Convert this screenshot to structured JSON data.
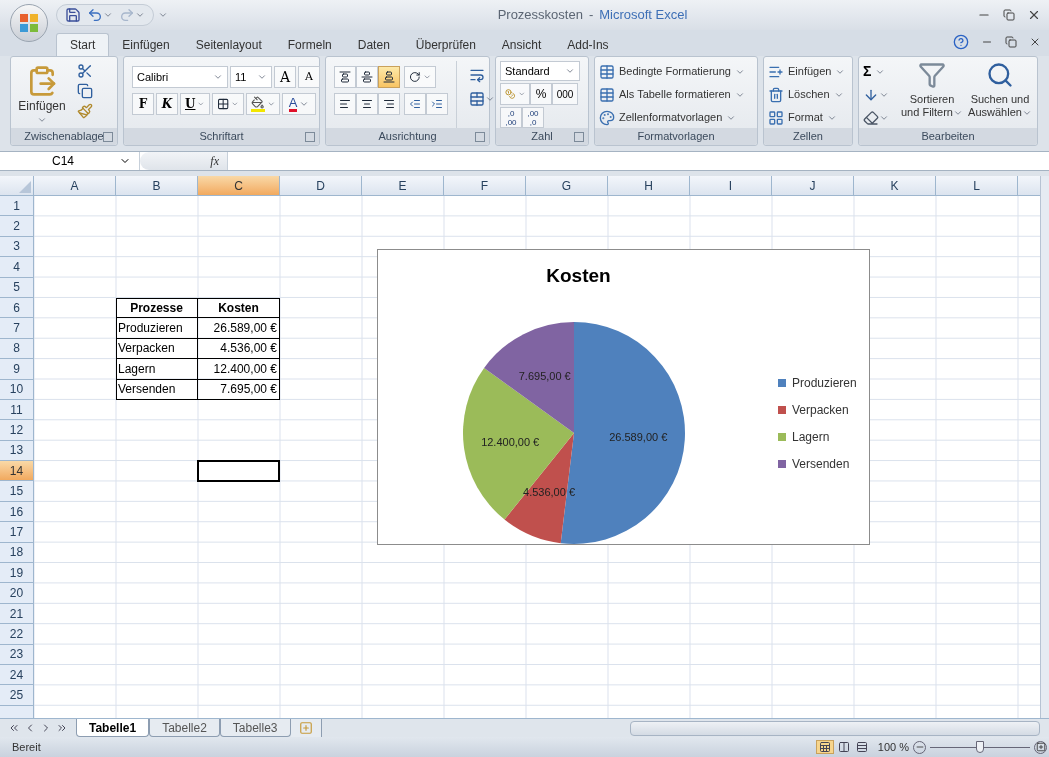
{
  "title": {
    "document": "Prozesskosten",
    "separator": "-",
    "app": "Microsoft Excel"
  },
  "ribbon_tabs": [
    {
      "label": "Start",
      "selected": true
    },
    {
      "label": "Einfügen",
      "selected": false
    },
    {
      "label": "Seitenlayout",
      "selected": false
    },
    {
      "label": "Formeln",
      "selected": false
    },
    {
      "label": "Daten",
      "selected": false
    },
    {
      "label": "Überprüfen",
      "selected": false
    },
    {
      "label": "Ansicht",
      "selected": false
    },
    {
      "label": "Add-Ins",
      "selected": false
    }
  ],
  "ribbon": {
    "clipboard": {
      "label": "Zwischenablage",
      "paste": "Einfügen"
    },
    "font": {
      "label": "Schriftart",
      "font_name": "Calibri",
      "font_size": "11",
      "grow": "A",
      "shrink": "A",
      "bold": "F",
      "italic": "K",
      "underline": "U",
      "font_color": "A"
    },
    "alignment": {
      "label": "Ausrichtung",
      "vertical_align": [
        {
          "selected": false
        },
        {
          "selected": false
        },
        {
          "selected": true
        }
      ]
    },
    "number": {
      "label": "Zahl",
      "format": "Standard",
      "percent": "%",
      "thousands": "000",
      "decimals": [
        {
          "top": ",0",
          "bottom": ",00"
        },
        {
          "top": ",00",
          "bottom": ",0"
        }
      ]
    },
    "styles": {
      "label": "Formatvorlagen",
      "items": [
        "Bedingte Formatierung",
        "Als Tabelle formatieren",
        "Zellenformatvorlagen"
      ]
    },
    "cells": {
      "label": "Zellen",
      "items": [
        "Einfügen",
        "Löschen",
        "Format"
      ]
    },
    "editing": {
      "label": "Bearbeiten",
      "sum": "Σ",
      "sort": [
        "Sortieren",
        "und Filtern"
      ],
      "find": [
        "Suchen und",
        "Auswählen"
      ]
    }
  },
  "formula_bar": {
    "name_box": "C14",
    "function_label": "fx"
  },
  "columns": [
    {
      "label": "A",
      "selected": false
    },
    {
      "label": "B",
      "selected": false
    },
    {
      "label": "C",
      "selected": true
    },
    {
      "label": "D",
      "selected": false
    },
    {
      "label": "E",
      "selected": false
    },
    {
      "label": "F",
      "selected": false
    },
    {
      "label": "G",
      "selected": false
    },
    {
      "label": "H",
      "selected": false
    },
    {
      "label": "I",
      "selected": false
    },
    {
      "label": "J",
      "selected": false
    },
    {
      "label": "K",
      "selected": false
    },
    {
      "label": "L",
      "selected": false
    }
  ],
  "rows": [
    {
      "label": "1",
      "selected": false
    },
    {
      "label": "2",
      "selected": false
    },
    {
      "label": "3",
      "selected": false
    },
    {
      "label": "4",
      "selected": false
    },
    {
      "label": "5",
      "selected": false
    },
    {
      "label": "6",
      "selected": false
    },
    {
      "label": "7",
      "selected": false
    },
    {
      "label": "8",
      "selected": false
    },
    {
      "label": "9",
      "selected": false
    },
    {
      "label": "10",
      "selected": false
    },
    {
      "label": "11",
      "selected": false
    },
    {
      "label": "12",
      "selected": false
    },
    {
      "label": "13",
      "selected": false
    },
    {
      "label": "14",
      "selected": true
    },
    {
      "label": "15",
      "selected": false
    },
    {
      "label": "16",
      "selected": false
    },
    {
      "label": "17",
      "selected": false
    },
    {
      "label": "18",
      "selected": false
    },
    {
      "label": "19",
      "selected": false
    },
    {
      "label": "20",
      "selected": false
    },
    {
      "label": "21",
      "selected": false
    },
    {
      "label": "22",
      "selected": false
    },
    {
      "label": "23",
      "selected": false
    },
    {
      "label": "24",
      "selected": false
    },
    {
      "label": "25",
      "selected": false
    }
  ],
  "table": {
    "columns": [
      "Prozesse",
      "Kosten"
    ],
    "rows": [
      [
        "Produzieren",
        "26.589,00 €"
      ],
      [
        "Verpacken",
        "4.536,00 €"
      ],
      [
        "Lagern",
        "12.400,00 €"
      ],
      [
        "Versenden",
        "7.695,00 €"
      ]
    ]
  },
  "chart": {
    "chart_data": {
      "type": "pie",
      "title": "Kosten",
      "categories": [
        "Produzieren",
        "Verpacken",
        "Lagern",
        "Versenden"
      ],
      "values": [
        26589,
        4536,
        12400,
        7695
      ],
      "colors": [
        "#4f81bd",
        "#c0504d",
        "#9bbb59",
        "#8064a2"
      ],
      "data_labels": true,
      "legend": "right",
      "value_labels": [
        "26.589,00 €",
        "4.536,00 €",
        "12.400,00 €",
        "7.695,00 €"
      ]
    }
  },
  "sheet_tabs": [
    {
      "label": "Tabelle1",
      "selected": true
    },
    {
      "label": "Tabelle2",
      "selected": false
    },
    {
      "label": "Tabelle3",
      "selected": false
    }
  ],
  "status_bar": {
    "status": "Bereit",
    "zoom": {
      "label": "100 %",
      "level": 0.5
    }
  }
}
